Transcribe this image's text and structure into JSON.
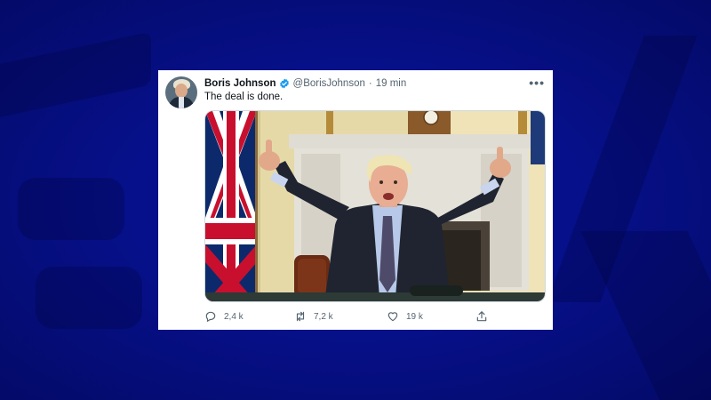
{
  "tweet": {
    "author_name": "Boris Johnson",
    "verified": true,
    "handle": "@BorisJohnson",
    "separator": "·",
    "time": "19 min",
    "more_label": "•••",
    "text": "The deal is done.",
    "image_description": "Boris Johnson giving double thumbs up in a room with a Union Jack flag, fireplace and clock",
    "stats": {
      "replies": "2,4 k",
      "retweets": "7,2 k",
      "likes": "19 k"
    }
  },
  "colors": {
    "background": "#050a6a",
    "verified_blue": "#1d9bf0",
    "text_primary": "#0f1419",
    "text_secondary": "#536471"
  },
  "icons": [
    "verified-badge-icon",
    "more-icon",
    "reply-icon",
    "retweet-icon",
    "like-icon",
    "share-icon"
  ]
}
